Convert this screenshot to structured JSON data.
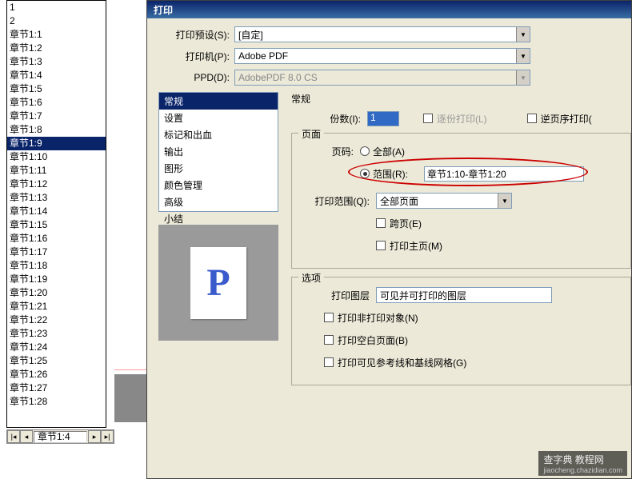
{
  "page_list": {
    "items": [
      "1",
      "2",
      "章节1:1",
      "章节1:2",
      "章节1:3",
      "章节1:4",
      "章节1:5",
      "章节1:6",
      "章节1:7",
      "章节1:8",
      "章节1:9",
      "章节1:10",
      "章节1:11",
      "章节1:12",
      "章节1:13",
      "章节1:14",
      "章节1:15",
      "章节1:16",
      "章节1:17",
      "章节1:18",
      "章节1:19",
      "章节1:20",
      "章节1:21",
      "章节1:22",
      "章节1:23",
      "章节1:24",
      "章节1:25",
      "章节1:26",
      "章节1:27",
      "章节1:28"
    ],
    "selected_index": 10,
    "status": "章节1:4"
  },
  "dialog": {
    "title": "打印",
    "preset_label": "打印预设(S):",
    "preset_value": "[自定]",
    "printer_label": "打印机(P):",
    "printer_value": "Adobe PDF",
    "ppd_label": "PPD(D):",
    "ppd_value": "AdobePDF 8.0 CS"
  },
  "categories": {
    "items": [
      "常规",
      "设置",
      "标记和出血",
      "输出",
      "图形",
      "颜色管理",
      "高级",
      "小结"
    ],
    "selected_index": 0
  },
  "general": {
    "title": "常规",
    "copies_label": "份数(I):",
    "copies_value": "1",
    "collate_label": "逐份打印(L)",
    "reverse_label": "逆页序打印("
  },
  "pages": {
    "title": "页面",
    "page_label": "页码:",
    "all_label": "全部(A)",
    "range_label": "范围(R):",
    "range_value": "章节1:10-章节1:20",
    "scope_label": "打印范围(Q):",
    "scope_value": "全部页面",
    "spread_label": "跨页(E)",
    "master_label": "打印主页(M)"
  },
  "options": {
    "title": "选项",
    "layers_label": "打印图层",
    "layers_value": "可见并可打印的图层",
    "nonprint_label": "打印非打印对象(N)",
    "blank_label": "打印空白页面(B)",
    "guides_label": "打印可见参考线和基线网格(G)"
  },
  "preview": {
    "letter": "P"
  },
  "watermark": {
    "main": "查字典 教程网",
    "sub": "jiaocheng.chazidian.com"
  }
}
